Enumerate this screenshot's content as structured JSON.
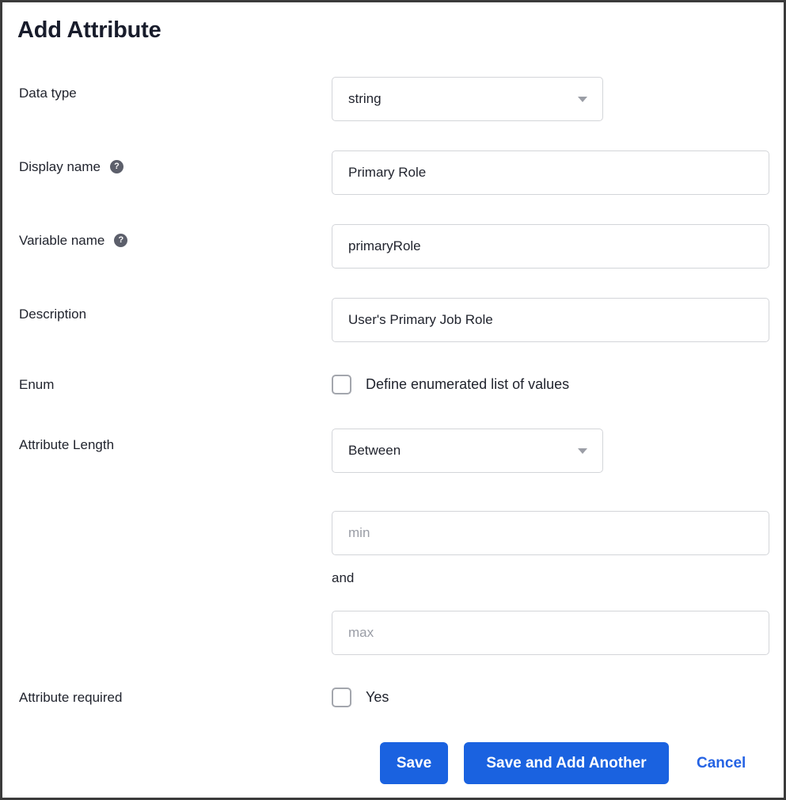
{
  "dialog": {
    "title": "Add Attribute"
  },
  "fields": {
    "data_type": {
      "label": "Data type",
      "value": "string",
      "control": "select",
      "caret_icon": "chevron-down-icon"
    },
    "display_name": {
      "label": "Display name",
      "help_icon": "help-question-icon",
      "help_glyph": "?",
      "value": "Primary Role",
      "control": "text"
    },
    "variable_name": {
      "label": "Variable name",
      "help_icon": "help-question-icon",
      "help_glyph": "?",
      "value": "primaryRole",
      "control": "text"
    },
    "description": {
      "label": "Description",
      "value": "User's Primary Job Role",
      "control": "text"
    },
    "enum": {
      "label": "Enum",
      "checkbox_label": "Define enumerated list of values",
      "checked": false
    },
    "attribute_length": {
      "label": "Attribute Length",
      "value": "Between",
      "control": "select",
      "caret_icon": "chevron-down-icon",
      "min_placeholder": "min",
      "min_value": "",
      "conjunction": "and",
      "max_placeholder": "max",
      "max_value": ""
    },
    "attribute_required": {
      "label": "Attribute required",
      "checkbox_label": "Yes",
      "checked": false
    }
  },
  "actions": {
    "save_label": "Save",
    "save_and_add_another_label": "Save and Add Another",
    "cancel_label": "Cancel"
  },
  "colors": {
    "primary_button": "#1a62e0",
    "link": "#2563e4",
    "text": "#21242e",
    "placeholder": "#9a9da6",
    "border": "#d3d5d9",
    "frame_border": "#3b3b3b",
    "help_icon_bg": "#5c5f6b"
  }
}
